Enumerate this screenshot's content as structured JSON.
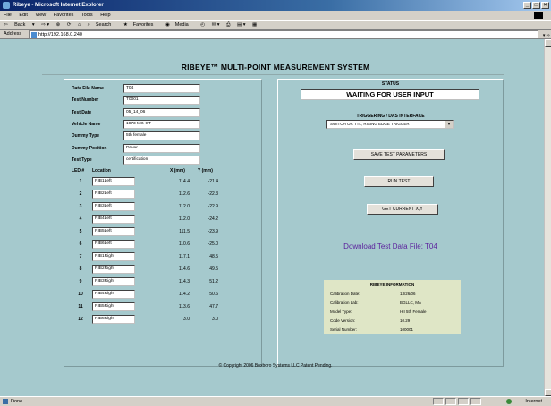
{
  "browser": {
    "window_title": "Ribeye - Microsoft Internet Explorer",
    "menu": [
      "File",
      "Edit",
      "View",
      "Favorites",
      "Tools",
      "Help"
    ],
    "toolbar": {
      "back_label": "Back",
      "search_label": "Search",
      "favorites_label": "Favorites",
      "media_label": "Media"
    },
    "address_label": "Address",
    "address_value": "http://192.168.0.240",
    "status_text": "Done",
    "zone_text": "Internet"
  },
  "app": {
    "title": "RIBEYE™ MULTI-POINT MEASUREMENT SYSTEM",
    "copyright": "© Copyright 2006 Boxboro Systems LLC Patent Pending."
  },
  "form": {
    "fields": [
      {
        "label": "Data File Name",
        "value": "T04"
      },
      {
        "label": "Test Number",
        "value": "T0001"
      },
      {
        "label": "Test Date",
        "value": "05_14_06"
      },
      {
        "label": "Vehicle Name",
        "value": "1973 MG-GT"
      },
      {
        "label": "Dummy Type",
        "value": "5th female"
      },
      {
        "label": "Dummy Position",
        "value": "Driver"
      },
      {
        "label": "Test Type",
        "value": "certification"
      }
    ]
  },
  "led_table": {
    "headers": {
      "led": "LED #",
      "location": "Location",
      "x": "X (mm)",
      "y": "Y (mm)"
    },
    "rows": [
      {
        "num": "1",
        "loc": "RIB1Left",
        "x": "114.4",
        "y": "-21.4"
      },
      {
        "num": "2",
        "loc": "RIB2Left",
        "x": "112.6",
        "y": "-22.3"
      },
      {
        "num": "3",
        "loc": "RIB3Left",
        "x": "112.0",
        "y": "-22.9"
      },
      {
        "num": "4",
        "loc": "RIB4Left",
        "x": "112.0",
        "y": "-24.2"
      },
      {
        "num": "5",
        "loc": "RIB5Left",
        "x": "111.5",
        "y": "-23.9"
      },
      {
        "num": "6",
        "loc": "RIB6Left",
        "x": "110.6",
        "y": "-25.0"
      },
      {
        "num": "7",
        "loc": "RIB1Right",
        "x": "117.1",
        "y": "48.5"
      },
      {
        "num": "8",
        "loc": "RIB2Right",
        "x": "114.6",
        "y": "49.5"
      },
      {
        "num": "9",
        "loc": "RIB3Right",
        "x": "114.3",
        "y": "51.2"
      },
      {
        "num": "10",
        "loc": "RIB4Right",
        "x": "114.2",
        "y": "50.6"
      },
      {
        "num": "11",
        "loc": "RIB5Right",
        "x": "113.6",
        "y": "47.7"
      },
      {
        "num": "12",
        "loc": "RIB6Right",
        "x": "3.0",
        "y": "3.0"
      }
    ]
  },
  "status": {
    "heading": "STATUS",
    "value": "WAITING FOR USER INPUT"
  },
  "triggering": {
    "heading": "TRIGGERING / DAS INTERFACE",
    "selected": "SWITCH OR TTL, RISING EDGE TRIGGER"
  },
  "buttons": {
    "save": "SAVE TEST PARAMETERS",
    "run": "RUN TEST",
    "get_xy": "GET CURRENT X,Y"
  },
  "download_link": "Download Test Data File: T04",
  "info": {
    "title": "RIBEYE INFORMATION",
    "rows": [
      {
        "k": "Calibration Date:",
        "v": "13/26/06"
      },
      {
        "k": "Calibration Lab:",
        "v": "BGLLC, MA"
      },
      {
        "k": "Model Type:",
        "v": "HII 5th Female"
      },
      {
        "k": "Code Version:",
        "v": "10.29"
      },
      {
        "k": "Serial Number:",
        "v": "100001"
      }
    ]
  },
  "colors": {
    "page_background": "#a5c9cd",
    "info_box_background": "#dfe6c6",
    "link_color": "#5a1e9c"
  }
}
